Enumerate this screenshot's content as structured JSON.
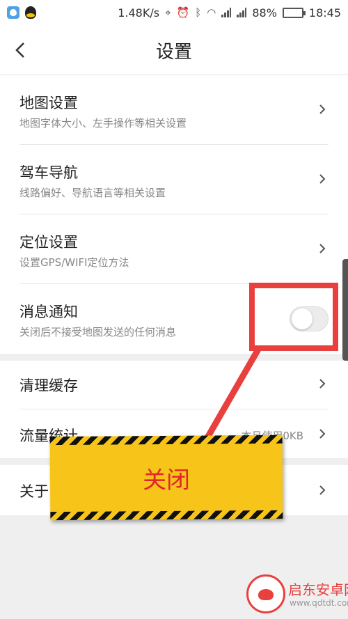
{
  "status_bar": {
    "network_speed": "1.48K/s",
    "battery_percent": "88%",
    "battery_level": 0.88,
    "time": "18:45",
    "icons": [
      "app-icon",
      "qq-icon",
      "location-icon",
      "alarm-icon",
      "bluetooth-icon",
      "wifi-icon",
      "signal-icon",
      "signal-icon",
      "battery-icon"
    ]
  },
  "header": {
    "title": "设置",
    "back_icon": "chevron-left-icon"
  },
  "settings": {
    "rows": [
      {
        "title": "地图设置",
        "subtitle": "地图字体大小、左手操作等相关设置"
      },
      {
        "title": "驾车导航",
        "subtitle": "线路偏好、导航语言等相关设置"
      },
      {
        "title": "定位设置",
        "subtitle": "设置GPS/WIFI定位方法"
      },
      {
        "title": "消息通知",
        "subtitle": "关闭后不接受地图发送的任何消息",
        "toggle": false
      }
    ],
    "rows2": [
      {
        "title": "清理缓存"
      },
      {
        "title": "流量统计",
        "value": "本月使用0KB"
      }
    ],
    "rows3": [
      {
        "title": "关于"
      }
    ]
  },
  "annotation": {
    "banner_text": "关闭",
    "highlight_color": "#e8403f",
    "banner_color": "#f7c51a"
  },
  "watermark": {
    "name": "启东安卓网",
    "url": "www.qdtdt.com"
  }
}
